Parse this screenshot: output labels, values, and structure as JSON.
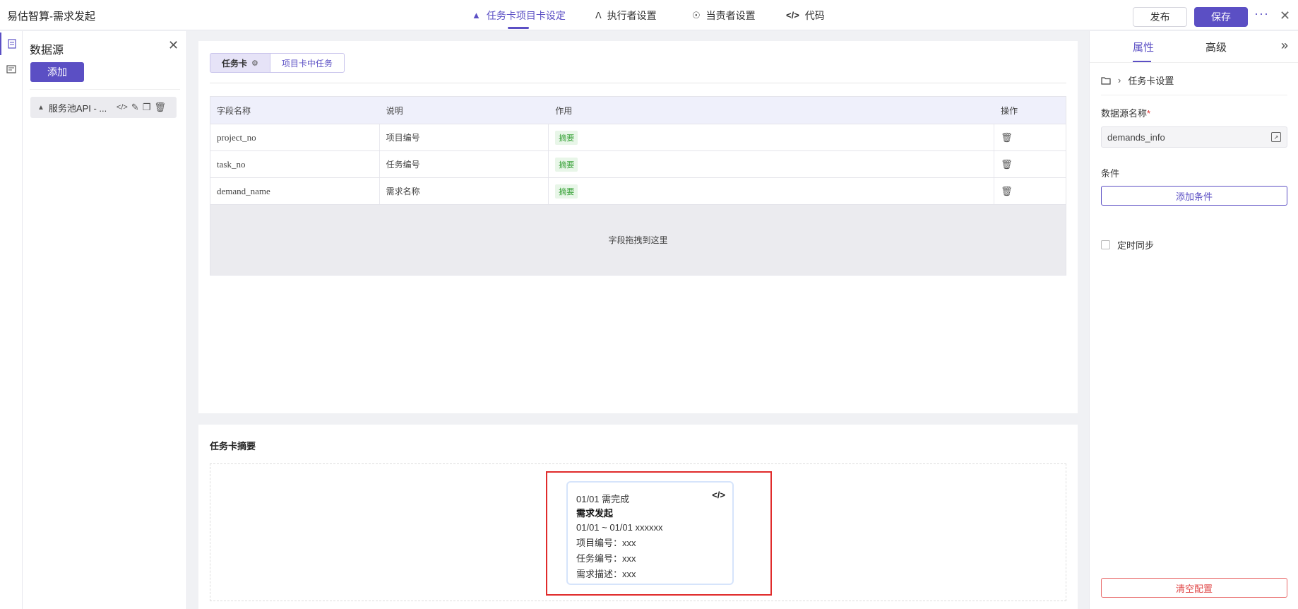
{
  "app": {
    "title": "易估智算-需求发起"
  },
  "top_tabs": [
    {
      "label": "任务卡项目卡设定",
      "icon": "cube-icon"
    },
    {
      "label": "执行者设置",
      "icon": "executor-icon"
    },
    {
      "label": "当责者设置",
      "icon": "responsible-icon"
    },
    {
      "label": "代码",
      "icon": "code-icon"
    }
  ],
  "toolbar": {
    "publish_label": "发布",
    "save_label": "保存"
  },
  "left_panel": {
    "title": "数据源",
    "add_label": "添加",
    "items": [
      {
        "label": "服务池API - ..."
      }
    ]
  },
  "main": {
    "segments": [
      {
        "label": "任务卡"
      },
      {
        "label": "项目卡中任务"
      }
    ],
    "table": {
      "columns": [
        "字段名称",
        "说明",
        "作用",
        "操作"
      ],
      "rows": [
        {
          "field": "project_no",
          "desc": "项目编号",
          "role": "摘要"
        },
        {
          "field": "task_no",
          "desc": "任务编号",
          "role": "摘要"
        },
        {
          "field": "demand_name",
          "desc": "需求名称",
          "role": "摘要"
        }
      ],
      "dropzone_text": "字段拖拽到这里"
    },
    "summary": {
      "title": "任务卡摘要",
      "card": {
        "line1": "01/01 需完成",
        "title": "需求发起",
        "line3": "01/01 ~ 01/01 xxxxxx",
        "line4": "项目编号：xxx",
        "line5": "任务编号：xxx",
        "line6": "需求描述：xxx"
      }
    }
  },
  "right_panel": {
    "tabs": [
      "属性",
      "高级"
    ],
    "breadcrumb": "任务卡设置",
    "datasource_label": "数据源名称",
    "required_mark": "*",
    "datasource_value": "demands_info",
    "condition_label": "条件",
    "add_condition_label": "添加条件",
    "sync_label": "定时同步",
    "clear_label": "清空配置"
  },
  "colors": {
    "accent": "#5b4fc4",
    "danger": "#e02b2b",
    "tag_green": "#3aa33a"
  }
}
